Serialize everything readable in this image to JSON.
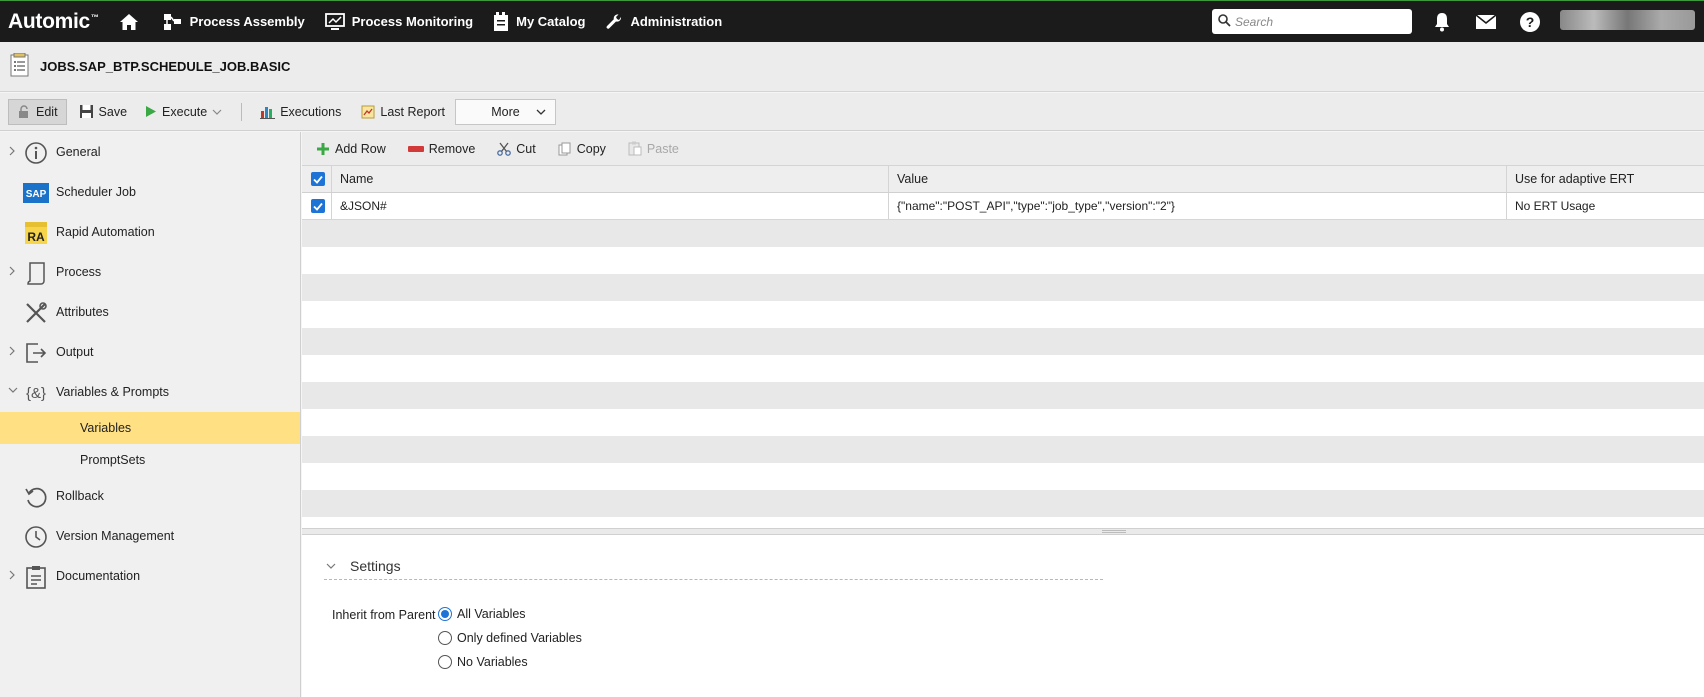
{
  "topbar": {
    "logo": "Automic",
    "nav": [
      "Process Assembly",
      "Process Monitoring",
      "My Catalog",
      "Administration"
    ],
    "search_placeholder": "Search"
  },
  "object": {
    "title": "JOBS.SAP_BTP.SCHEDULE_JOB.BASIC"
  },
  "toolbar": {
    "edit": "Edit",
    "save": "Save",
    "execute": "Execute",
    "executions": "Executions",
    "last_report": "Last Report",
    "more": "More"
  },
  "sidebar": {
    "items": [
      {
        "label": "General",
        "icon": "info-icon",
        "expandable": true
      },
      {
        "label": "Scheduler Job",
        "icon": "sap-icon",
        "expandable": false
      },
      {
        "label": "Rapid Automation",
        "icon": "ra-icon",
        "expandable": false
      },
      {
        "label": "Process",
        "icon": "process-icon",
        "expandable": true
      },
      {
        "label": "Attributes",
        "icon": "tools-icon",
        "expandable": false
      },
      {
        "label": "Output",
        "icon": "output-icon",
        "expandable": true
      },
      {
        "label": "Variables & Prompts",
        "icon": "variables-icon",
        "expandable": true
      }
    ],
    "sub": [
      "Variables",
      "PromptSets"
    ],
    "items2": [
      {
        "label": "Rollback",
        "icon": "rollback-icon"
      },
      {
        "label": "Version Management",
        "icon": "clock-icon"
      },
      {
        "label": "Documentation",
        "icon": "clipboard-icon"
      }
    ]
  },
  "grid": {
    "toolbar": {
      "add_row": "Add Row",
      "remove": "Remove",
      "cut": "Cut",
      "copy": "Copy",
      "paste": "Paste"
    },
    "columns": [
      "Name",
      "Value",
      "Use for adaptive ERT"
    ],
    "rows": [
      {
        "name": "&JSON#",
        "value": "{\"name\":\"POST_API\",\"type\":\"job_type\",\"version\":\"2\"}",
        "ert": "No ERT Usage"
      }
    ]
  },
  "settings": {
    "title": "Settings",
    "inherit_label": "Inherit from Parent",
    "options": [
      "All Variables",
      "Only defined Variables",
      "No Variables"
    ],
    "selected": "All Variables"
  },
  "colors": {
    "accent": "#1e74d6",
    "selected": "#ffe083",
    "topbar": "#1b1b1b"
  }
}
